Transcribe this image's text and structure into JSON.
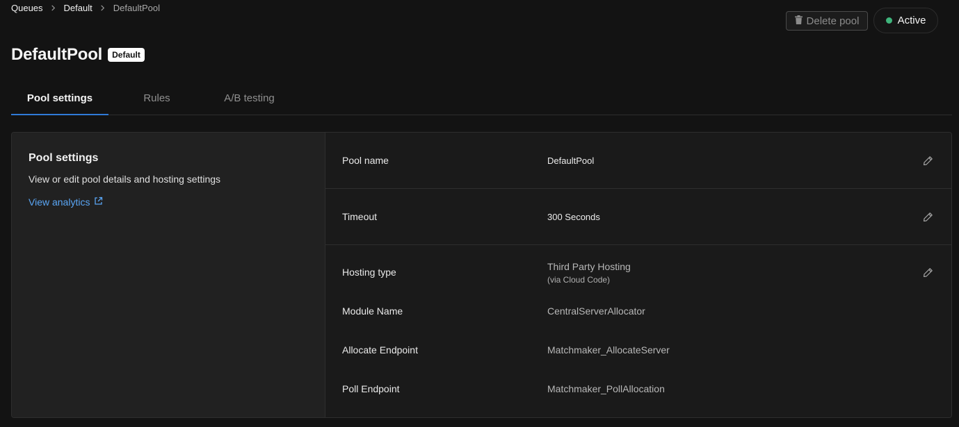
{
  "breadcrumb": {
    "items": [
      "Queues",
      "Default",
      "DefaultPool"
    ]
  },
  "header": {
    "title": "DefaultPool",
    "badge": "Default",
    "delete_label": "Delete pool",
    "status_label": "Active",
    "status_color": "#3fb57c"
  },
  "tabs": [
    {
      "label": "Pool settings",
      "active": true
    },
    {
      "label": "Rules",
      "active": false
    },
    {
      "label": "A/B testing",
      "active": false
    }
  ],
  "left_panel": {
    "title": "Pool settings",
    "description": "View or edit pool details and hosting settings",
    "link_label": "View analytics"
  },
  "settings": {
    "pool_name": {
      "label": "Pool name",
      "value": "DefaultPool"
    },
    "timeout": {
      "label": "Timeout",
      "value": "300 Seconds"
    },
    "hosting": {
      "label": "Hosting type",
      "value": "Third Party Hosting",
      "sub": "(via Cloud Code)",
      "module_label": "Module Name",
      "module_value": "CentralServerAllocator",
      "allocate_label": "Allocate Endpoint",
      "allocate_value": "Matchmaker_AllocateServer",
      "poll_label": "Poll Endpoint",
      "poll_value": "Matchmaker_PollAllocation"
    }
  },
  "colors": {
    "accent": "#2f7ad8",
    "link": "#5aa6f5",
    "background": "#131313"
  },
  "icons": [
    "chevron-right-icon",
    "trash-icon",
    "external-link-icon",
    "pencil-icon"
  ]
}
